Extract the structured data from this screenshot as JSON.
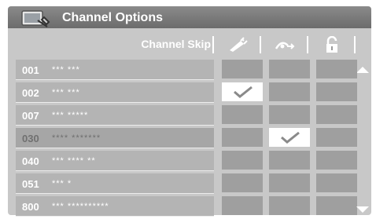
{
  "window": {
    "title": "Channel Options"
  },
  "header": {
    "column_label": "Channel Skip",
    "icons": [
      "hide-channel-icon",
      "auto-play-icon",
      "lock-icon"
    ]
  },
  "rows": [
    {
      "number": "001",
      "name": "*** ***",
      "col1": false,
      "col2": false,
      "col3": false
    },
    {
      "number": "002",
      "name": "*** ***",
      "col1": true,
      "col2": false,
      "col3": false
    },
    {
      "number": "007",
      "name": "*** *****",
      "col1": false,
      "col2": false,
      "col3": false
    },
    {
      "number": "030",
      "name": "**** *******",
      "col1": false,
      "col2": true,
      "col3": false,
      "highlighted": true
    },
    {
      "number": "040",
      "name": "*** **** **",
      "col1": false,
      "col2": false,
      "col3": false
    },
    {
      "number": "051",
      "name": "*** *",
      "col1": false,
      "col2": false,
      "col3": false
    },
    {
      "number": "800",
      "name": "*** **********",
      "col1": false,
      "col2": false,
      "col3": false
    }
  ]
}
